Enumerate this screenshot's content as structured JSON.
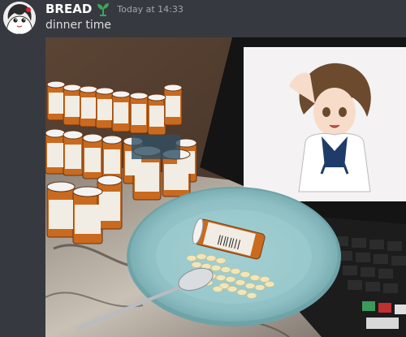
{
  "message": {
    "author": "BREAD",
    "role_icon": "seedling-icon",
    "timestamp": "Today at 14:33",
    "text": "dinner time"
  },
  "attachment": {
    "type": "photo",
    "depicts": "dinner-plate-of-pills-photo"
  },
  "colors": {
    "background": "#36393f",
    "username": "#ffffff",
    "timestamp": "#a3a6aa",
    "message_text": "#dcddde",
    "role_icon": "#3ba55c"
  }
}
